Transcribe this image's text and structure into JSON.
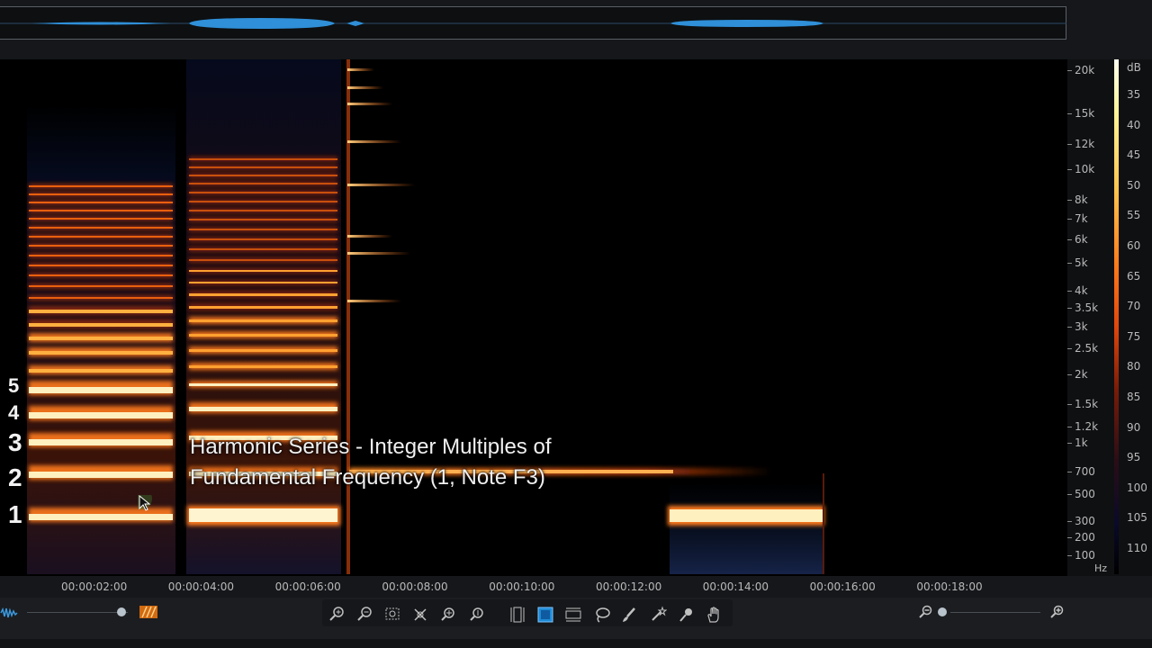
{
  "harmonic_labels": [
    "5",
    "4",
    "3",
    "2",
    "1"
  ],
  "caption": {
    "line1": "Harmonic Series - Integer Multiples of",
    "line2": "Fundamental Frequency (1, Note F3)"
  },
  "freq_axis": {
    "labels": [
      "20k",
      "15k",
      "12k",
      "10k",
      "8k",
      "7k",
      "6k",
      "5k",
      "4k",
      "3.5k",
      "3k",
      "2.5k",
      "2k",
      "1.5k",
      "1.2k",
      "1k",
      "700",
      "500",
      "300",
      "200",
      "100"
    ],
    "unit": "Hz"
  },
  "db_scale": {
    "unit": "dB",
    "labels": [
      "35",
      "40",
      "45",
      "50",
      "55",
      "60",
      "65",
      "70",
      "75",
      "80",
      "85",
      "90",
      "95",
      "100",
      "105",
      "110"
    ]
  },
  "time_ruler": {
    "labels": [
      "00:00:02:00",
      "00:00:04:00",
      "00:00:06:00",
      "00:00:08:00",
      "00:00:10:00",
      "00:00:12:00",
      "00:00:14:00",
      "00:00:16:00",
      "00:00:18:00"
    ]
  },
  "toolbar": {
    "icons": [
      "zoom-in-time-icon",
      "zoom-out-time-icon",
      "zoom-selection-icon",
      "zoom-fit-icon",
      "zoom-in-freq-icon",
      "zoom-out-freq-icon",
      "time-selection-icon",
      "time-freq-selection-icon",
      "freq-selection-icon",
      "lasso-icon",
      "brush-icon",
      "magic-wand-icon",
      "harmonic-selection-icon",
      "hand-icon"
    ]
  },
  "colors": {
    "harmonic_core": "#fff4c8",
    "harmonic_glow": "#ff7a1a",
    "waveform": "#2f8fd8",
    "active_tool": "#1e8ad6"
  }
}
